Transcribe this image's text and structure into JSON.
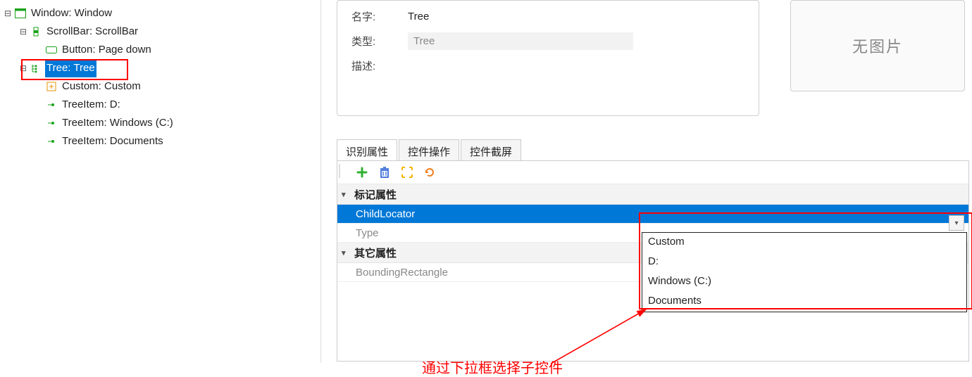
{
  "tree": {
    "items": [
      {
        "label": "Window: Window"
      },
      {
        "label": "ScrollBar: ScrollBar"
      },
      {
        "label": "Button: Page down"
      },
      {
        "label": "Tree: Tree"
      },
      {
        "label": "Custom: Custom"
      },
      {
        "label": "TreeItem: D:"
      },
      {
        "label": "TreeItem: Windows  (C:)"
      },
      {
        "label": "TreeItem: Documents"
      }
    ]
  },
  "props": {
    "name_label": "名字:",
    "name_value": "Tree",
    "type_label": "类型:",
    "type_value": "Tree",
    "desc_label": "描述:"
  },
  "image_placeholder": "无图片",
  "tabs": {
    "a": "识别属性",
    "b": "控件操作",
    "c": "控件截屏"
  },
  "grid": {
    "section1": "标记属性",
    "row_childlocator": "ChildLocator",
    "row_type": "Type",
    "section2": "其它属性",
    "row_bounding": "BoundingRectangle"
  },
  "dropdown": {
    "opt0": "Custom",
    "opt1": "D:",
    "opt2": "Windows  (C:)",
    "opt3": "Documents"
  },
  "annotation": "通过下拉框选择子控件"
}
